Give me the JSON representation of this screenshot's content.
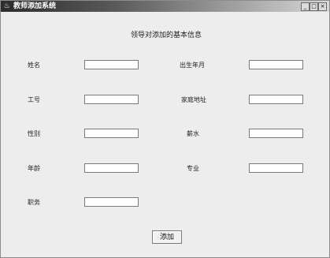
{
  "window": {
    "title": "教师添加系统",
    "minimize_glyph": "_",
    "maximize_glyph": "□",
    "close_glyph": "×"
  },
  "form": {
    "heading": "领导对添加的基本信息",
    "fields": {
      "name": {
        "label": "姓名",
        "value": ""
      },
      "birth": {
        "label": "出生年月",
        "value": ""
      },
      "id": {
        "label": "工号",
        "value": ""
      },
      "address": {
        "label": "家庭地址",
        "value": ""
      },
      "gender": {
        "label": "性别",
        "value": ""
      },
      "salary": {
        "label": "薪水",
        "value": ""
      },
      "age": {
        "label": "年龄",
        "value": ""
      },
      "major": {
        "label": "专业",
        "value": ""
      },
      "position": {
        "label": "职务",
        "value": ""
      }
    },
    "submit_label": "添加"
  }
}
